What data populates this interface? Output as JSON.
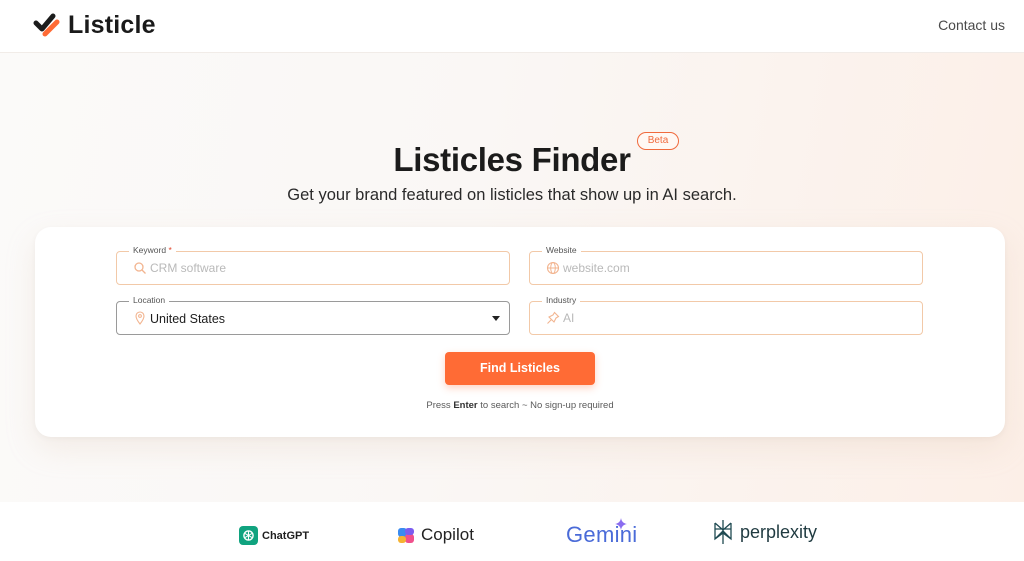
{
  "brand": {
    "name": "Listicle"
  },
  "header": {
    "contact_label": "Contact us"
  },
  "hero": {
    "title": "Listicles Finder",
    "badge": "Beta",
    "subtitle": "Get your brand featured on listicles that show up in AI search."
  },
  "form": {
    "keyword": {
      "label": "Keyword",
      "required_mark": "*",
      "placeholder": "CRM software",
      "icon": "search-icon"
    },
    "website": {
      "label": "Website",
      "placeholder": "website.com",
      "icon": "globe-icon"
    },
    "location": {
      "label": "Location",
      "value": "United States",
      "icon": "location-pin-icon"
    },
    "industry": {
      "label": "Industry",
      "placeholder": "AI",
      "icon": "pin-icon"
    },
    "submit_label": "Find Listicles",
    "hint_prefix": "Press",
    "hint_key": "Enter",
    "hint_suffix": "to search ~ No sign-up required"
  },
  "ai_logos": [
    {
      "name": "ChatGPT",
      "color": "#10a37f"
    },
    {
      "name": "Copilot",
      "color": "#7b5cf0"
    },
    {
      "name": "Gemini",
      "color": "#4a6bd8"
    },
    {
      "name": "perplexity",
      "color": "#1f3a40"
    }
  ],
  "colors": {
    "accent": "#ff6b35",
    "field_border": "#f2c9a8"
  }
}
